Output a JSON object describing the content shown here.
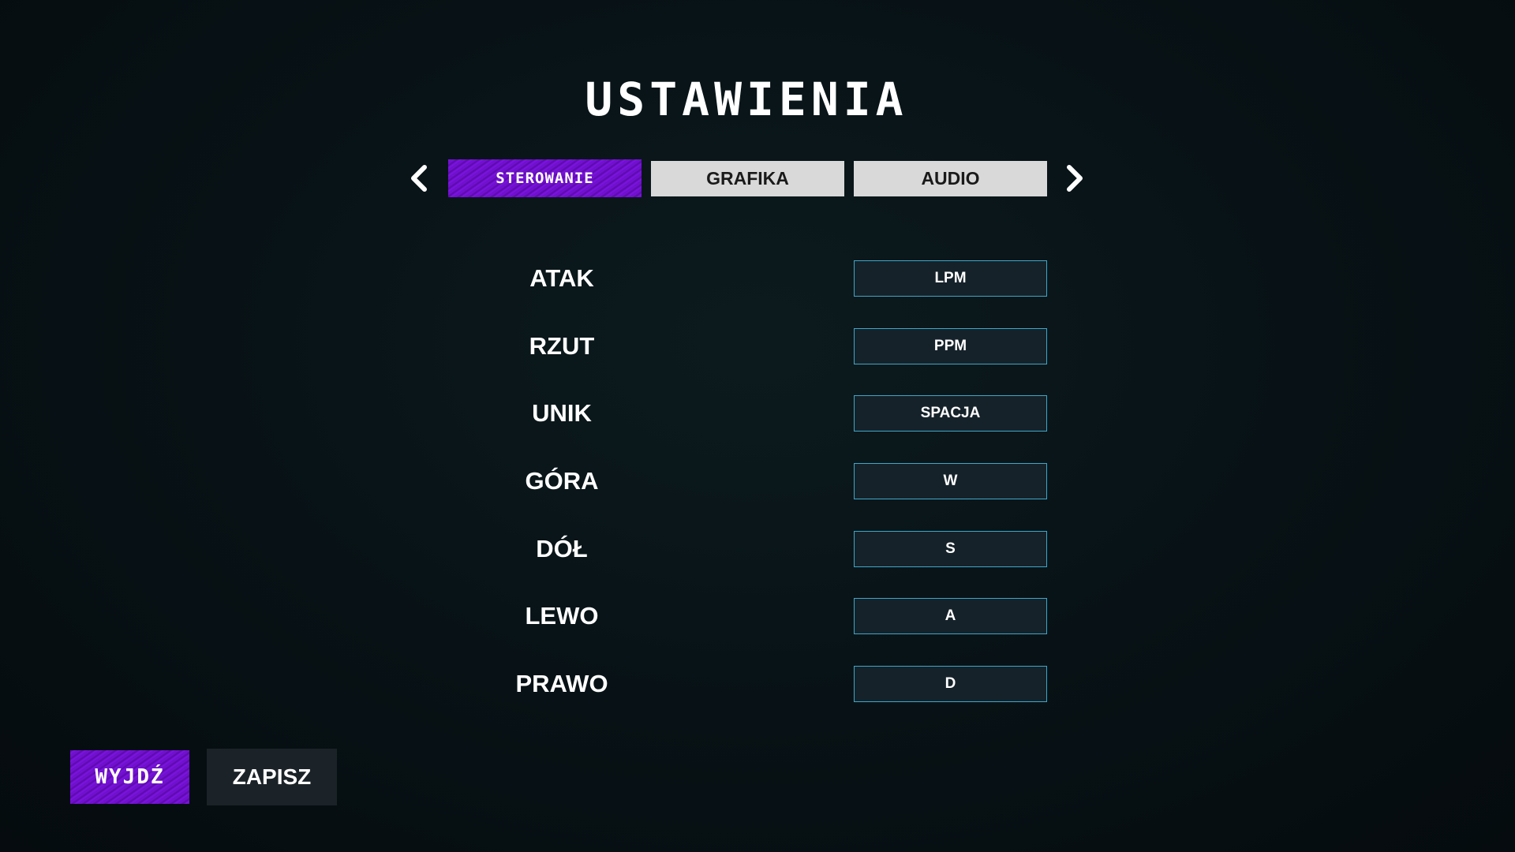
{
  "title": "USTAWIENIA",
  "tabs": [
    {
      "label": "STEROWANIE",
      "active": true
    },
    {
      "label": "GRAFIKA",
      "active": false
    },
    {
      "label": "AUDIO",
      "active": false
    }
  ],
  "icons": {
    "prev": "chevron-left-icon",
    "next": "chevron-right-icon"
  },
  "bindings": [
    {
      "action": "ATAK",
      "key": "LPM"
    },
    {
      "action": "RZUT",
      "key": "PPM"
    },
    {
      "action": "UNIK",
      "key": "SPACJA"
    },
    {
      "action": "GÓRA",
      "key": "W"
    },
    {
      "action": "DÓŁ",
      "key": "S"
    },
    {
      "action": "LEWO",
      "key": "A"
    },
    {
      "action": "PRAWO",
      "key": "D"
    }
  ],
  "footer": {
    "exit_label": "WYJDŹ",
    "save_label": "ZAPISZ"
  },
  "colors": {
    "accent_purple": "#7312d6",
    "key_border": "#3ea6c8",
    "background": "#081317",
    "tab_inactive": "#d9d9d9"
  }
}
